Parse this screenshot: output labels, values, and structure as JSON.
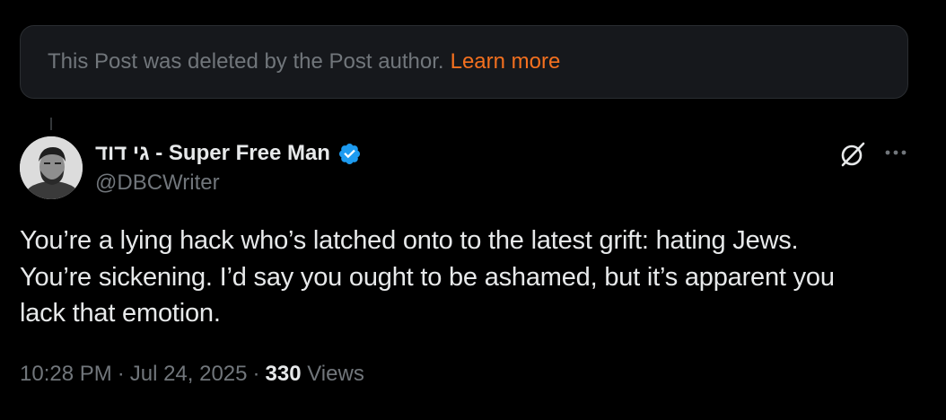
{
  "deleted_notice": {
    "text": "This Post was deleted by the Post author.",
    "link_label": "Learn more",
    "link_color": "#f4701f"
  },
  "post": {
    "author_name": "גי דוד - Super Free Man",
    "author_handle": "@DBCWriter",
    "verified": true,
    "text_lines": [
      "You’re a lying hack who’s latched onto to the latest grift: hating Jews.",
      "You’re sickening. I’d say you ought to be ashamed, but it’s apparent you",
      "lack that emotion."
    ],
    "time": "10:28 PM",
    "date": "Jul 24, 2025",
    "separator": "·",
    "views_count": "330",
    "views_label": "Views"
  },
  "icons": {
    "verified": "verified-badge-icon",
    "grok": "grok-icon",
    "more": "more-options-icon"
  },
  "colors": {
    "background": "#000000",
    "card": "#16181c",
    "text_primary": "#e7e9ea",
    "text_secondary": "#71767b",
    "verified_blue": "#1d9bf0"
  }
}
